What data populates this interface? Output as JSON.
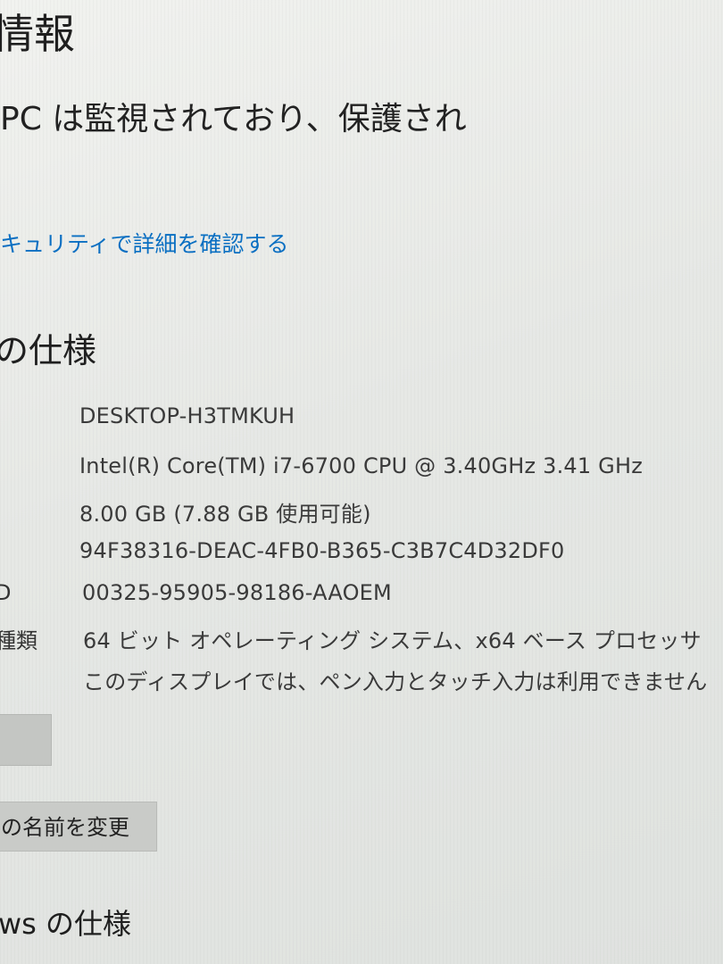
{
  "header": {
    "title": "情報",
    "status": "PC は監視されており、保護され"
  },
  "security": {
    "link_text": "キュリティで詳細を確認する"
  },
  "device_specs": {
    "heading": "の仕様",
    "rows": [
      {
        "label": "",
        "value": "DESKTOP-H3TMKUH"
      },
      {
        "label": "",
        "value": "Intel(R) Core(TM) i7-6700 CPU @ 3.40GHz   3.41 GHz"
      },
      {
        "label": "",
        "value": "8.00 GB (7.88 GB 使用可能)"
      },
      {
        "label": "",
        "value": "94F38316-DEAC-4FB0-B365-C3B7C4D32DF0"
      },
      {
        "label": "D",
        "value": "00325-95905-98186-AAOEM"
      },
      {
        "label": "種類",
        "value": "64 ビット オペレーティング システム、x64 ベース プロセッサ"
      },
      {
        "label": "",
        "value": "このディスプレイでは、ペン入力とタッチ入力は利用できません"
      }
    ]
  },
  "buttons": {
    "copy_label": "",
    "rename_label": "の名前を変更"
  },
  "windows_specs": {
    "heading": "ws の仕様"
  }
}
